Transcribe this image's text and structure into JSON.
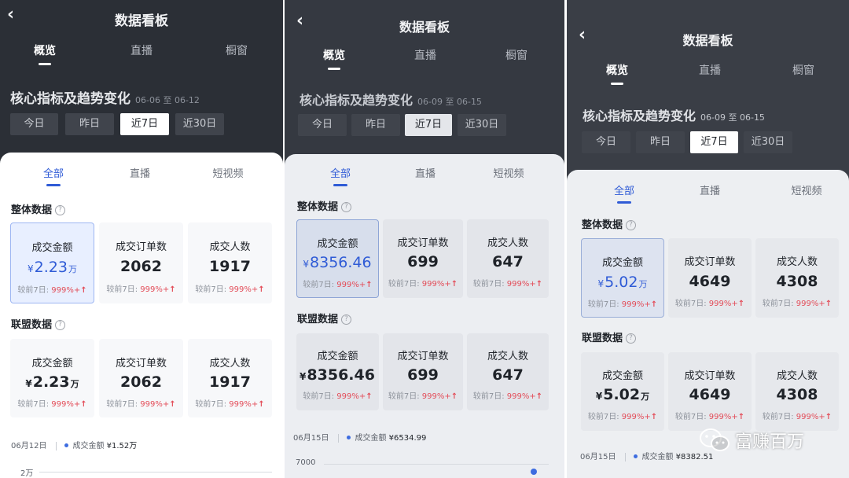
{
  "screens": [
    {
      "title": "数据看板",
      "tabs": [
        "概览",
        "直播",
        "橱窗"
      ],
      "section_title": "核心指标及趋势变化",
      "date_range": "06-06 至 06-12",
      "period_buttons": [
        "今日",
        "昨日",
        "近7日",
        "近30日"
      ],
      "sub_tabs": [
        "全部",
        "直播",
        "短视频"
      ],
      "overall": {
        "title": "整体数据",
        "cards": [
          {
            "label": "成交金额",
            "currency": "¥",
            "value": "2.23",
            "unit": "万",
            "compare": "较前7日: ",
            "pct": "999%+",
            "arrow": "↑"
          },
          {
            "label": "成交订单数",
            "currency": "",
            "value": "2062",
            "unit": "",
            "compare": "较前7日: ",
            "pct": "999%+",
            "arrow": "↑"
          },
          {
            "label": "成交人数",
            "currency": "",
            "value": "1917",
            "unit": "",
            "compare": "较前7日: ",
            "pct": "999%+",
            "arrow": "↑"
          }
        ]
      },
      "alliance": {
        "title": "联盟数据",
        "cards": [
          {
            "label": "成交金额",
            "currency": "¥",
            "value": "2.23",
            "unit": "万",
            "compare": "较前7日: ",
            "pct": "999%+",
            "arrow": "↑"
          },
          {
            "label": "成交订单数",
            "currency": "",
            "value": "2062",
            "unit": "",
            "compare": "较前7日: ",
            "pct": "999%+",
            "arrow": "↑"
          },
          {
            "label": "成交人数",
            "currency": "",
            "value": "1917",
            "unit": "",
            "compare": "较前7日: ",
            "pct": "999%+",
            "arrow": "↑"
          }
        ]
      },
      "footer": {
        "date": "06月12日",
        "metric": "成交金额",
        "value": "¥1.52万"
      },
      "axis_label": "2万"
    },
    {
      "title": "数据看板",
      "tabs": [
        "概览",
        "直播",
        "橱窗"
      ],
      "section_title": "核心指标及趋势变化",
      "date_range": "06-09 至 06-15",
      "period_buttons": [
        "今日",
        "昨日",
        "近7日",
        "近30日"
      ],
      "sub_tabs": [
        "全部",
        "直播",
        "短视频"
      ],
      "overall": {
        "title": "整体数据",
        "cards": [
          {
            "label": "成交金额",
            "currency": "¥",
            "value": "8356.46",
            "unit": "",
            "compare": "较前7日: ",
            "pct": "999%+",
            "arrow": "↑"
          },
          {
            "label": "成交订单数",
            "currency": "",
            "value": "699",
            "unit": "",
            "compare": "较前7日: ",
            "pct": "999%+",
            "arrow": "↑"
          },
          {
            "label": "成交人数",
            "currency": "",
            "value": "647",
            "unit": "",
            "compare": "较前7日: ",
            "pct": "999%+",
            "arrow": "↑"
          }
        ]
      },
      "alliance": {
        "title": "联盟数据",
        "cards": [
          {
            "label": "成交金额",
            "currency": "¥",
            "value": "8356.46",
            "unit": "",
            "compare": "较前7日: ",
            "pct": "999%+",
            "arrow": "↑"
          },
          {
            "label": "成交订单数",
            "currency": "",
            "value": "699",
            "unit": "",
            "compare": "较前7日: ",
            "pct": "999%+",
            "arrow": "↑"
          },
          {
            "label": "成交人数",
            "currency": "",
            "value": "647",
            "unit": "",
            "compare": "较前7日: ",
            "pct": "999%+",
            "arrow": "↑"
          }
        ]
      },
      "footer": {
        "date": "06月15日",
        "metric": "成交金额",
        "value": "¥6534.99"
      },
      "axis_label": "7000"
    },
    {
      "title": "数据看板",
      "tabs": [
        "概览",
        "直播",
        "橱窗"
      ],
      "section_title": "核心指标及趋势变化",
      "date_range": "06-09 至 06-15",
      "period_buttons": [
        "今日",
        "昨日",
        "近7日",
        "近30日"
      ],
      "sub_tabs": [
        "全部",
        "直播",
        "短视频"
      ],
      "overall": {
        "title": "整体数据",
        "cards": [
          {
            "label": "成交金额",
            "currency": "¥",
            "value": "5.02",
            "unit": "万",
            "compare": "较前7日: ",
            "pct": "999%+",
            "arrow": "↑"
          },
          {
            "label": "成交订单数",
            "currency": "",
            "value": "4649",
            "unit": "",
            "compare": "较前7日: ",
            "pct": "999%+",
            "arrow": "↑"
          },
          {
            "label": "成交人数",
            "currency": "",
            "value": "4308",
            "unit": "",
            "compare": "较前7日: ",
            "pct": "999%+",
            "arrow": "↑"
          }
        ]
      },
      "alliance": {
        "title": "联盟数据",
        "cards": [
          {
            "label": "成交金额",
            "currency": "¥",
            "value": "5.02",
            "unit": "万",
            "compare": "较前7日: ",
            "pct": "999%+",
            "arrow": "↑"
          },
          {
            "label": "成交订单数",
            "currency": "",
            "value": "4649",
            "unit": "",
            "compare": "较前7日: ",
            "pct": "999%+",
            "arrow": "↑"
          },
          {
            "label": "成交人数",
            "currency": "",
            "value": "4308",
            "unit": "",
            "compare": "较前7日: ",
            "pct": "999%+",
            "arrow": "↑"
          }
        ]
      },
      "footer": {
        "date": "06月15日",
        "metric": "成交金额",
        "value": "¥8382.51"
      },
      "axis_label": ""
    }
  ],
  "watermark": {
    "text": "富赚百万",
    "icon": "wechat-icon"
  },
  "colors": {
    "accent": "#2f5bd6",
    "increase": "#e34d59",
    "header_bg": "#2b2f36"
  }
}
